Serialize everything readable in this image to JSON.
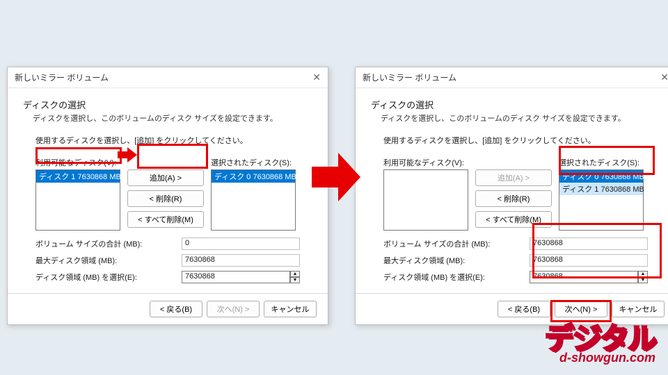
{
  "left": {
    "title": "新しいミラー ボリューム",
    "heading": "ディスクの選択",
    "subheading": "ディスクを選択し、このボリュームのディスク サイズを設定できます。",
    "instruction": "使用するディスクを選択し、[追加] をクリックしてください。",
    "available_label": "利用可能なディスク(V):",
    "selected_label": "選択されたディスク(S):",
    "available_items": [
      "ディスク 1   7630868 MB"
    ],
    "selected_items": [
      "ディスク 0   7630868 MB"
    ],
    "btn_add": "追加(A) >",
    "btn_remove": "< 削除(R)",
    "btn_remove_all": "< すべて削除(M)",
    "field_total_label": "ボリューム サイズの合計 (MB):",
    "field_total_value": "0",
    "field_max_label": "最大ディスク領域 (MB):",
    "field_max_value": "7630868",
    "field_sel_label": "ディスク領域 (MB) を選択(E):",
    "field_sel_value": "7630868",
    "btn_back": "< 戻る(B)",
    "btn_next": "次へ(N) >",
    "btn_cancel": "キャンセル"
  },
  "right": {
    "title": "新しいミラー ボリューム",
    "heading": "ディスクの選択",
    "subheading": "ディスクを選択し、このボリュームのディスク サイズを設定できます。",
    "instruction": "使用するディスクを選択し、[追加] をクリックしてください。",
    "available_label": "利用可能なディスク(V):",
    "selected_label": "選択されたディスク(S):",
    "available_items": [],
    "selected_items": [
      "ディスク 0   7630868 MB",
      "ディスク 1   7630868 MB"
    ],
    "btn_add": "追加(A) >",
    "btn_remove": "< 削除(R)",
    "btn_remove_all": "< すべて削除(M)",
    "field_total_label": "ボリューム サイズの合計 (MB):",
    "field_total_value": "7630868",
    "field_max_label": "最大ディスク領域 (MB):",
    "field_max_value": "7630868",
    "field_sel_label": "ディスク領域 (MB) を選択(E):",
    "field_sel_value": "7630868",
    "btn_back": "< 戻る(B)",
    "btn_next": "次へ(N) >",
    "btn_cancel": "キャンセル"
  },
  "logo": {
    "text": "デジタル",
    "url": "d-showgun.com"
  }
}
